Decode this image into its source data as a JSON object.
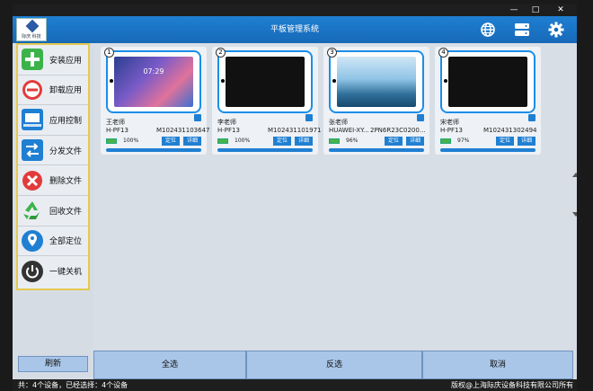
{
  "window": {
    "title": "平板管理系统",
    "minimize_glyph": "—",
    "maximize_glyph": "□",
    "close_glyph": "✕"
  },
  "header": {
    "logo_text": "际庆 科技",
    "icons": [
      "globe-icon",
      "server-icon",
      "gear-icon"
    ]
  },
  "sidebar": {
    "items": [
      {
        "label": "安装应用",
        "icon": "plus-circle-icon",
        "color": "#3cb34a"
      },
      {
        "label": "卸载应用",
        "icon": "minus-circle-icon",
        "color": "#e23b3b"
      },
      {
        "label": "应用控制",
        "icon": "monitor-control-icon",
        "color": "#1f7fd2"
      },
      {
        "label": "分发文件",
        "icon": "transfer-arrows-icon",
        "color": "#1f7fd2"
      },
      {
        "label": "删除文件",
        "icon": "delete-x-icon",
        "color": "#e23b3b"
      },
      {
        "label": "回收文件",
        "icon": "recycle-icon",
        "color": "#3cb34a"
      },
      {
        "label": "全部定位",
        "icon": "location-pin-icon",
        "color": "#1f7fd2"
      },
      {
        "label": "一键关机",
        "icon": "power-icon",
        "color": "#333333"
      }
    ],
    "refresh_label": "刷新"
  },
  "devices": [
    {
      "num": "1",
      "teacher": "王老师",
      "model": "H-PF13",
      "serial": "M102431103647",
      "battery": "100%",
      "locate": "定位",
      "details": "详细",
      "screen": "wallpaper",
      "clock": "07:29"
    },
    {
      "num": "2",
      "teacher": "李老师",
      "model": "H-PF13",
      "serial": "M102431101971",
      "battery": "100%",
      "locate": "定位",
      "details": "详细",
      "screen": "off"
    },
    {
      "num": "3",
      "teacher": "张老师",
      "model": "HUAWEI-XY...",
      "serial": "2PN6R23C0200...",
      "battery": "96%",
      "locate": "定位",
      "details": "详细",
      "screen": "ocean"
    },
    {
      "num": "4",
      "teacher": "宋老师",
      "model": "H-PF13",
      "serial": "M102431302494",
      "battery": "97%",
      "locate": "定位",
      "details": "详细",
      "screen": "off"
    }
  ],
  "actions": {
    "select_all": "全选",
    "invert": "反选",
    "cancel": "取消"
  },
  "status": {
    "left": "共：4个设备，已经选择：4个设备",
    "right": "版权@上海际庆设备科技有限公司所有"
  },
  "colors": {
    "accent": "#1f7fd2",
    "sidebar_border": "#e6c94e",
    "button_bg": "#a9c6e8"
  }
}
